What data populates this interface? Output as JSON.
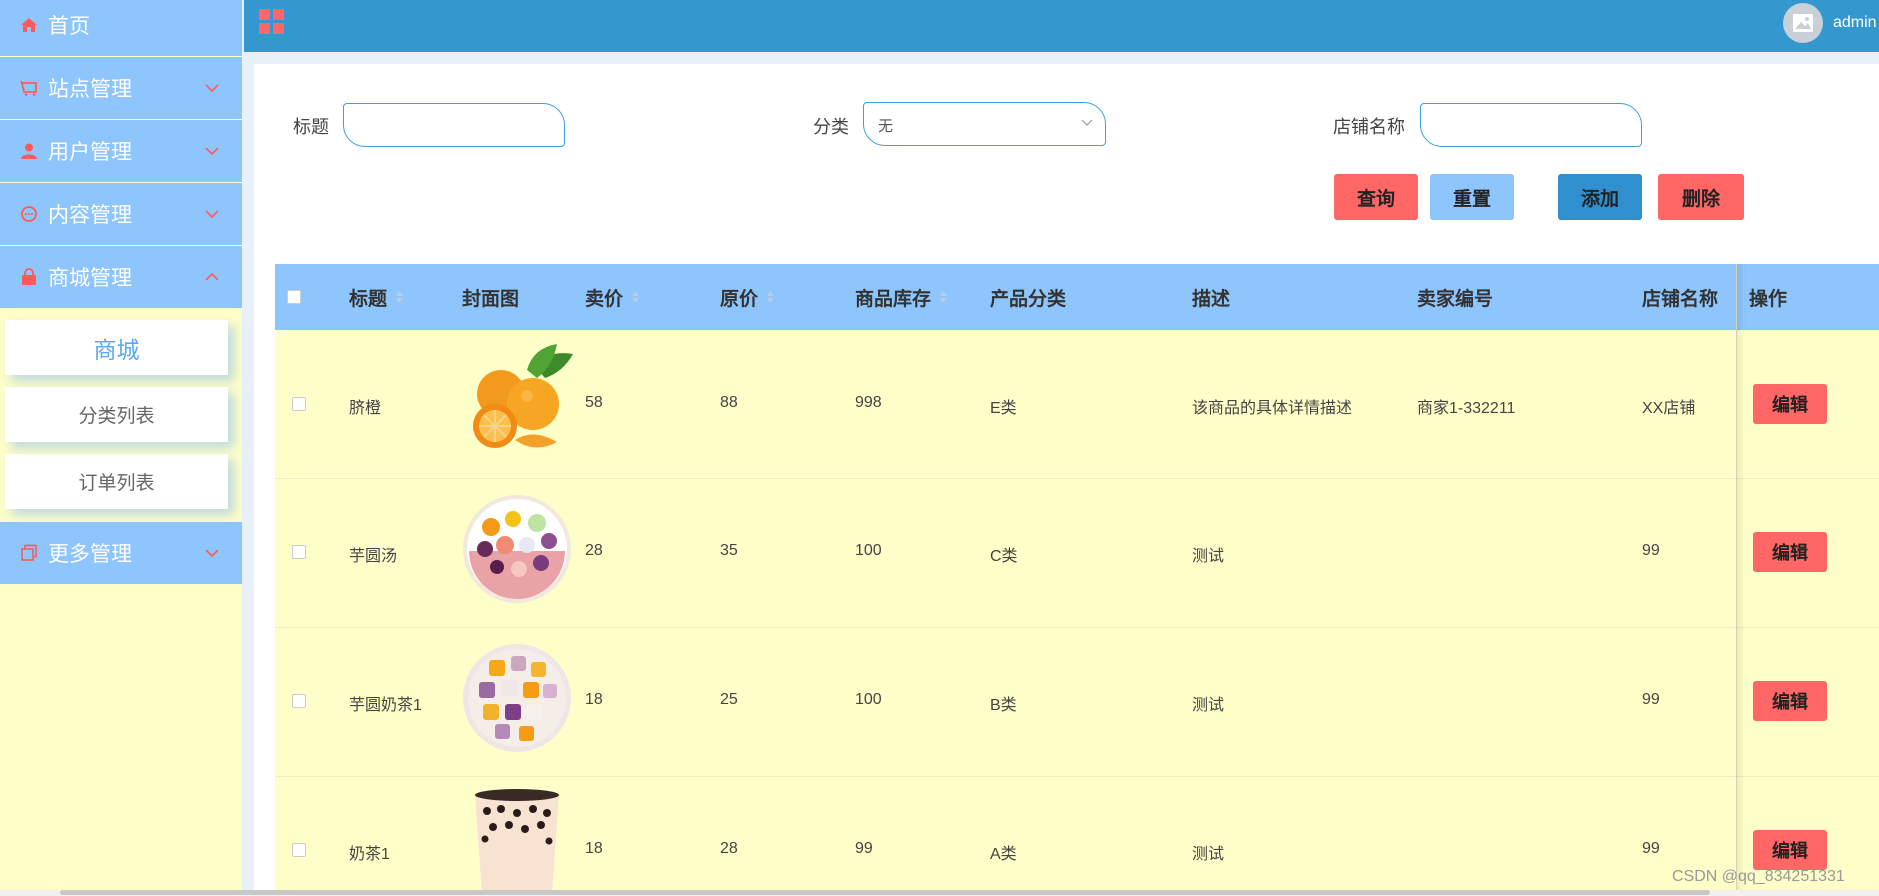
{
  "sidebar": {
    "home": "首页",
    "items": [
      "站点管理",
      "用户管理",
      "内容管理",
      "商城管理"
    ],
    "submenu": [
      "商城",
      "分类列表",
      "订单列表"
    ],
    "more": "更多管理"
  },
  "header": {
    "user": "admin"
  },
  "filters": {
    "title_label": "标题",
    "category_label": "分类",
    "category_value": "无",
    "shop_label": "店铺名称"
  },
  "buttons": {
    "query": "查询",
    "reset": "重置",
    "add": "添加",
    "delete": "删除"
  },
  "table": {
    "columns": [
      "标题",
      "封面图",
      "卖价",
      "原价",
      "商品库存",
      "产品分类",
      "描述",
      "卖家编号",
      "店铺名称",
      "操作"
    ],
    "rows": [
      {
        "title": "脐橙",
        "price": "58",
        "orig": "88",
        "stock": "998",
        "cat": "E类",
        "desc": "该商品的具体详情描述",
        "seller": "商家1-332211",
        "shop": "XX店铺",
        "action": "编辑"
      },
      {
        "title": "芋圆汤",
        "price": "28",
        "orig": "35",
        "stock": "100",
        "cat": "C类",
        "desc": "测试",
        "seller": "",
        "shop": "99",
        "action": "编辑"
      },
      {
        "title": "芋圆奶茶1",
        "price": "18",
        "orig": "25",
        "stock": "100",
        "cat": "B类",
        "desc": "测试",
        "seller": "",
        "shop": "99",
        "action": "编辑"
      },
      {
        "title": "奶茶1",
        "price": "18",
        "orig": "28",
        "stock": "99",
        "cat": "A类",
        "desc": "测试",
        "seller": "",
        "shop": "99",
        "action": "编辑"
      }
    ]
  },
  "watermark": "CSDN @qq_834251331",
  "colors": {
    "sidebar": "#8ec5fc",
    "header": "#3498cf",
    "danger": "#ff6666",
    "row_bg": "#fefec8",
    "accent": "#2f8fcf"
  },
  "icons": {
    "home": "home-icon",
    "site": "cart-icon",
    "user": "user-icon",
    "content": "chat-icon",
    "mall": "bag-icon",
    "more": "copy-icon",
    "header": "grid-icon",
    "avatar": "image-icon"
  }
}
